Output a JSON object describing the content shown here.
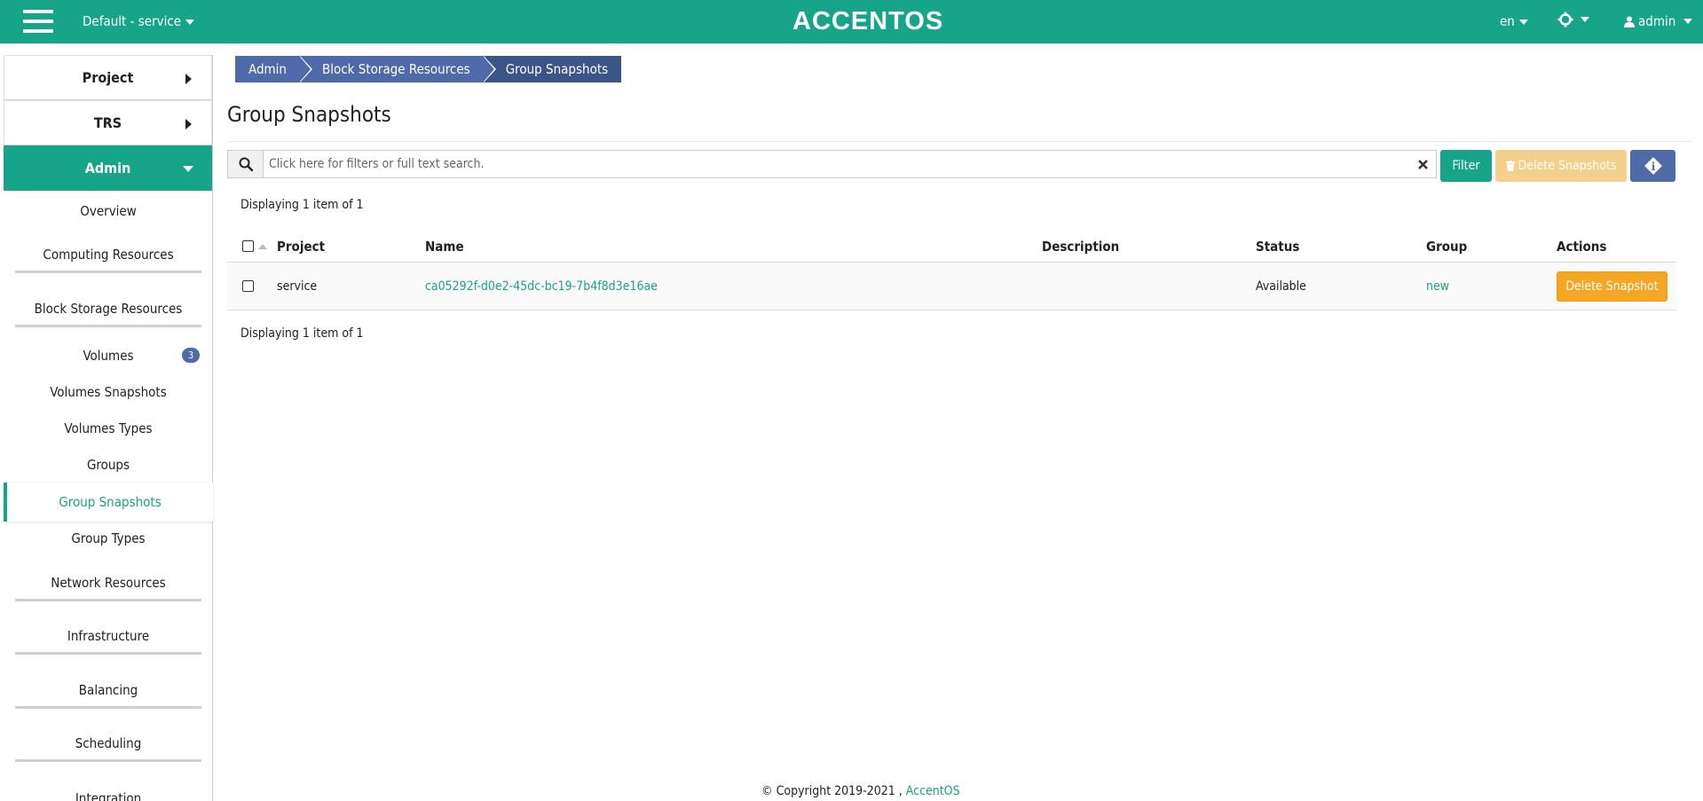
{
  "header": {
    "project_selector": "Default - service",
    "brand": "ACCENTOS",
    "language": "en",
    "user": "admin"
  },
  "sidebar": {
    "top_items": [
      {
        "label": "Project"
      },
      {
        "label": "TRS"
      },
      {
        "label": "Admin"
      }
    ],
    "items": [
      {
        "label": "Overview"
      },
      {
        "label": "Computing Resources"
      },
      {
        "label": "Block Storage Resources"
      },
      {
        "label": "Volumes",
        "badge": "3"
      },
      {
        "label": "Volumes Snapshots"
      },
      {
        "label": "Volumes Types"
      },
      {
        "label": "Groups"
      },
      {
        "label": "Group Snapshots"
      },
      {
        "label": "Group Types"
      },
      {
        "label": "Network Resources"
      },
      {
        "label": "Infrastructure"
      },
      {
        "label": "Balancing"
      },
      {
        "label": "Scheduling"
      },
      {
        "label": "Integration"
      }
    ]
  },
  "breadcrumb": [
    "Admin",
    "Block Storage Resources",
    "Group Snapshots"
  ],
  "page": {
    "title": "Group Snapshots",
    "search_placeholder": "Click here for filters or full text search.",
    "filter_button": "Filter",
    "delete_all_button": "Delete Snapshots",
    "displaying_top": "Displaying 1 item of 1",
    "displaying_bottom": "Displaying 1 item of 1"
  },
  "table": {
    "columns": [
      "Project",
      "Name",
      "Description",
      "Status",
      "Group",
      "Actions"
    ],
    "rows": [
      {
        "project": "service",
        "name": "ca05292f-d0e2-45dc-bc19-7b4f8d3e16ae",
        "description": "",
        "status": "Available",
        "group": "new",
        "action": "Delete Snapshot"
      }
    ]
  },
  "footer": {
    "copyright": "© Copyright 2019-2021 ,",
    "link": "AccentOS"
  },
  "colors": {
    "primary": "#17a589",
    "breadcrumb": "#4e6aa8",
    "warning": "#f5a623"
  }
}
